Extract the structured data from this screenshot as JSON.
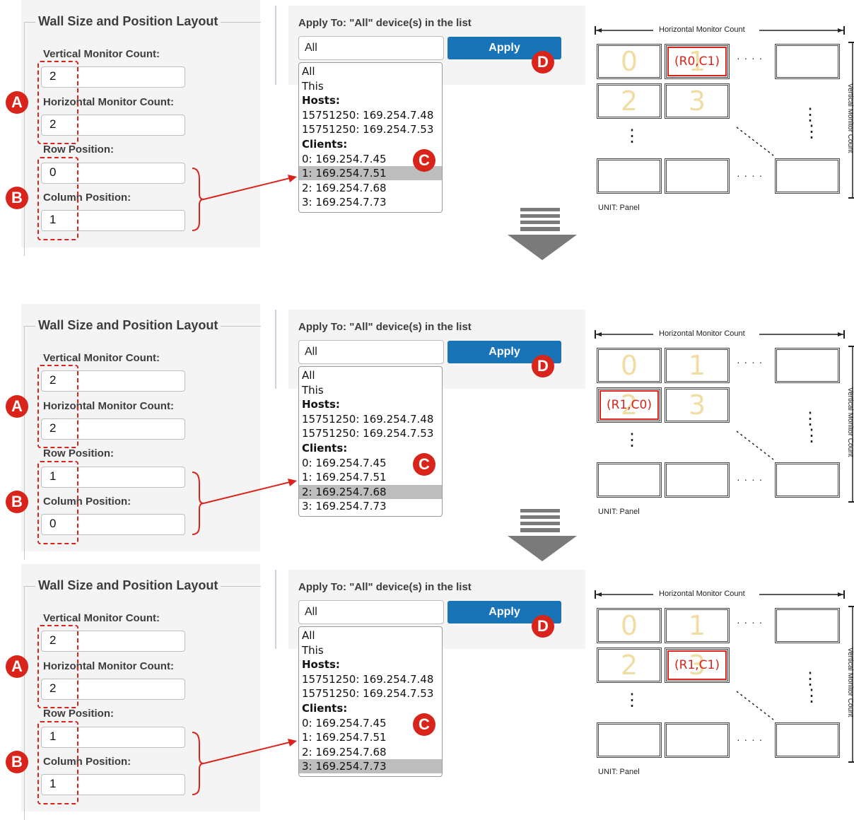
{
  "form": {
    "legend": "Wall Size and Position Layout",
    "vertical_label": "Vertical Monitor Count:",
    "horizontal_label": "Horizontal Monitor Count:",
    "row_label": "Row Position:",
    "column_label": "Column Position:"
  },
  "apply_to": {
    "label": "Apply To: \"All\" device(s) in the list",
    "select_value": "All",
    "apply_button": "Apply",
    "items": [
      {
        "text": "All",
        "bold": false
      },
      {
        "text": "This",
        "bold": false
      },
      {
        "text": "Hosts:",
        "bold": true
      },
      {
        "text": "15751250: 169.254.7.48",
        "bold": false
      },
      {
        "text": "15751250: 169.254.7.53",
        "bold": false
      },
      {
        "text": "Clients:",
        "bold": true
      },
      {
        "text": "0: 169.254.7.45",
        "bold": false
      },
      {
        "text": "1: 169.254.7.51",
        "bold": false
      },
      {
        "text": "2: 169.254.7.68",
        "bold": false
      },
      {
        "text": "3: 169.254.7.73",
        "bold": false
      }
    ]
  },
  "wall": {
    "horizontal_label": "Horizontal Monitor Count",
    "vertical_label": "Vertical Monitor Count",
    "unit_label": "UNIT: Panel",
    "cell_numbers": [
      "0",
      "1",
      "2",
      "3"
    ],
    "ellipsis_h": "· · · ·",
    "ellipsis_v": "⋮"
  },
  "callouts": {
    "a": "A",
    "b": "B",
    "c": "C",
    "d": "D"
  },
  "steps": [
    {
      "vertical": "2",
      "horizontal": "2",
      "row": "0",
      "column": "1",
      "selected_client": 7,
      "coord_label": "(R0,C1)",
      "coord_cell": 1
    },
    {
      "vertical": "2",
      "horizontal": "2",
      "row": "1",
      "column": "0",
      "selected_client": 8,
      "coord_label": "(R1,C0)",
      "coord_cell": 2
    },
    {
      "vertical": "2",
      "horizontal": "2",
      "row": "1",
      "column": "1",
      "selected_client": 9,
      "coord_label": "(R1,C1)",
      "coord_cell": 3
    }
  ],
  "colors": {
    "accent_red": "#d9241c",
    "apply_blue": "#1874b7",
    "selection_gray": "#bdbdbd",
    "cell_number": "#f1dca3"
  }
}
